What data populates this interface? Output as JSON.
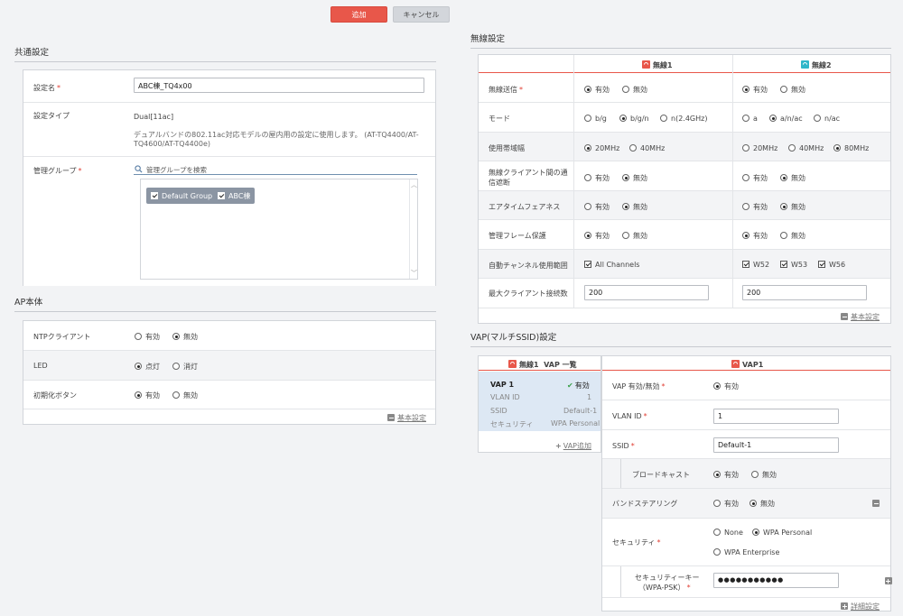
{
  "top_buttons": {
    "add": "追加",
    "cancel": "キャンセル"
  },
  "common": {
    "title": "共通設定",
    "name_label": "設定名",
    "name_value": "ABC棟_TQ4x00",
    "type_label": "設定タイプ",
    "type_value": "Dual[11ac]",
    "type_desc_1": "デュアルバンドの802.11ac対応モデルの屋内用の設定に使用します。 (AT-TQ4400/AT-",
    "type_desc_2": "TQ4600/AT-TQ4400e)",
    "group_label": "管理グループ",
    "group_search_placeholder": "管理グループを検索",
    "groups": [
      "Default Group",
      "ABC棟"
    ]
  },
  "ap": {
    "title": "AP本体",
    "rows": [
      {
        "label": "NTPクライアント",
        "opts": [
          "有効",
          "無効"
        ],
        "selected": 1
      },
      {
        "label": "LED",
        "opts": [
          "点灯",
          "消灯"
        ],
        "selected": 0
      },
      {
        "label": "初期化ボタン",
        "opts": [
          "有効",
          "無効"
        ],
        "selected": 0
      }
    ],
    "basic_link": "基本設定"
  },
  "wireless": {
    "title": "無線設定",
    "col1": "無線1",
    "col2": "無線2",
    "rows": [
      {
        "label": "無線送信",
        "req": true
      },
      {
        "label": "モード"
      },
      {
        "label": "使用帯域幅"
      },
      {
        "label": "無線クライアント間の通",
        "label2": "信遮断"
      },
      {
        "label": "エアタイムフェアネス"
      },
      {
        "label": "管理フレーム保護"
      },
      {
        "label": "自動チャンネル使用範囲"
      },
      {
        "label": "最大クライアント接続数"
      }
    ],
    "opts": {
      "on": "有効",
      "off": "無効",
      "bg": "b/g",
      "bgn": "b/g/n",
      "n24": "n(2.4GHz)",
      "a": "a",
      "anac": "a/n/ac",
      "nac": "n/ac",
      "mhz20": "20MHz",
      "mhz40": "40MHz",
      "mhz80": "80MHz",
      "all_channels": "All Channels",
      "w52": "W52",
      "w53": "W53",
      "w56": "W56"
    },
    "max1": "200",
    "max2": "200",
    "basic_link": "基本設定"
  },
  "vap": {
    "title": "VAP(マルチSSID)設定",
    "list_header_badge": "無線1",
    "list_header": "VAP 一覧",
    "item": {
      "name": "VAP 1",
      "status": "有効",
      "vlan_label": "VLAN ID",
      "vlan_value": "1",
      "ssid_label": "SSID",
      "ssid_value": "Default-1",
      "sec_label": "セキュリティ",
      "sec_value": "WPA Personal"
    },
    "add_link": "VAP追加",
    "detail_header": "VAP1",
    "enable_label": "VAP 有効/無効",
    "enable_opt": "有効",
    "vlan_label": "VLAN ID",
    "vlan_value": "1",
    "ssid_label": "SSID",
    "ssid_value": "Default-1",
    "broadcast_label": "ブロードキャスト",
    "band_label": "バンドステアリング",
    "security_label": "セキュリティ",
    "sec_opts": [
      "None",
      "WPA Personal",
      "WPA Enterprise"
    ],
    "key_label_1": "セキュリティーキー",
    "key_label_2": "（WPA-PSK）",
    "key_value": "●●●●●●●●●●●",
    "detail_link": "詳細設定",
    "on": "有効",
    "off": "無効"
  },
  "colors": {
    "accent": "#e8574a",
    "radio2": "#2fb6c9"
  }
}
